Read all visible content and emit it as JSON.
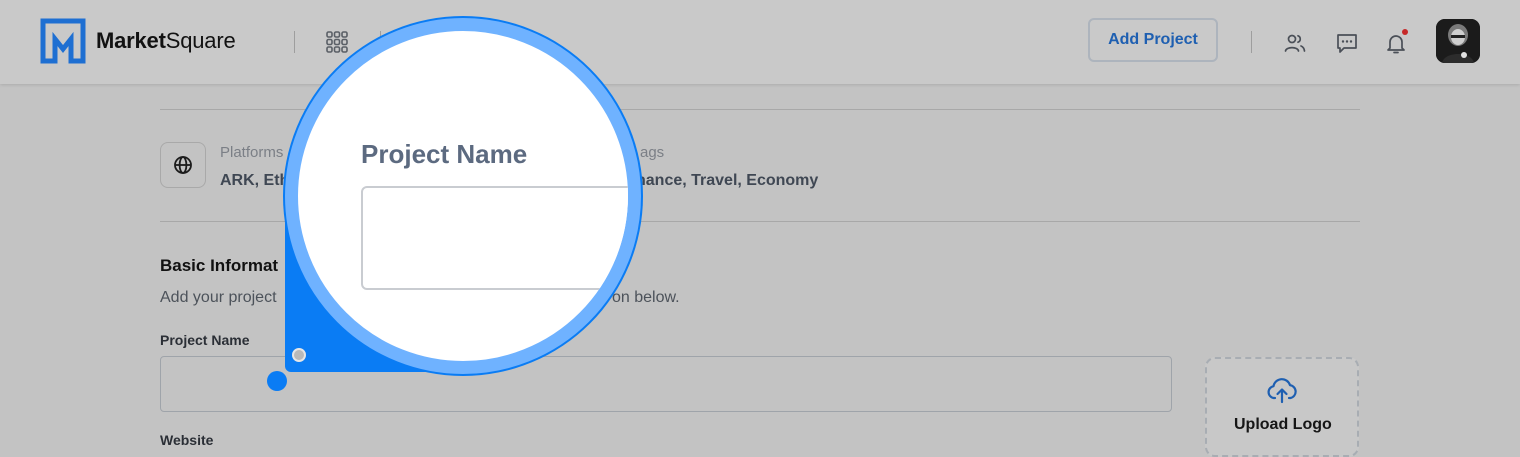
{
  "header": {
    "brand_bold": "Market",
    "brand_light": "Square",
    "add_project_label": "Add Project",
    "icons": [
      "apps-grid-icon",
      "users-icon",
      "chat-icon",
      "bell-icon"
    ],
    "accent_color": "#1e5fb1",
    "notification_dot_color": "#c62828"
  },
  "project_meta": {
    "platforms_label": "Platforms",
    "platforms_value": "ARK, Eth",
    "tags_label": "ags",
    "tags_value": "nance, Travel, Economy"
  },
  "basic_info": {
    "title": "Basic Informat",
    "description_left": "Add your project",
    "description_right": "on below."
  },
  "form": {
    "project_name_label": "Project Name",
    "project_name_value": "",
    "website_label": "Website",
    "upload_logo_label": "Upload Logo"
  },
  "magnifier": {
    "label": "Project Name",
    "input_value": "",
    "accent_color": "#0a7cf4"
  }
}
